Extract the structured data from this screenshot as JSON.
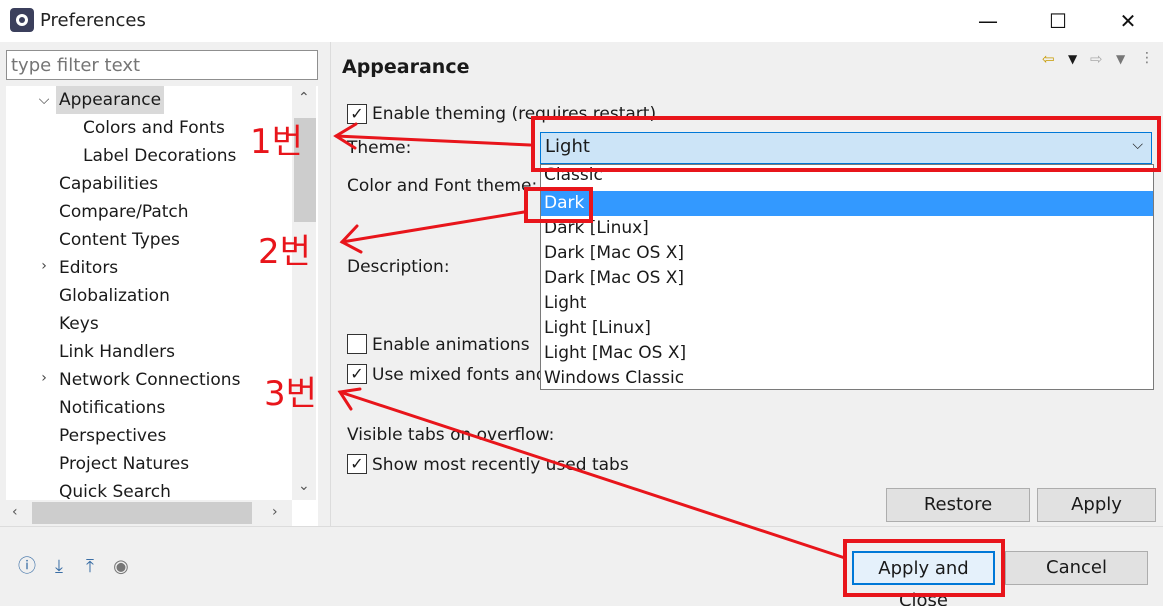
{
  "window": {
    "title": "Preferences",
    "minimize": "—",
    "maximize": "☐",
    "close": "✕"
  },
  "filter": {
    "placeholder": "type filter text"
  },
  "tree": {
    "items": [
      {
        "label": "Appearance",
        "twisty": "expanded",
        "selected": true
      },
      {
        "label": "Colors and Fonts"
      },
      {
        "label": "Label Decorations"
      },
      {
        "label": "Capabilities"
      },
      {
        "label": "Compare/Patch"
      },
      {
        "label": "Content Types"
      },
      {
        "label": "Editors",
        "twisty": "collapsed"
      },
      {
        "label": "Globalization"
      },
      {
        "label": "Keys"
      },
      {
        "label": "Link Handlers"
      },
      {
        "label": "Network Connections",
        "twisty": "collapsed"
      },
      {
        "label": "Notifications"
      },
      {
        "label": "Perspectives"
      },
      {
        "label": "Project Natures"
      },
      {
        "label": "Quick Search"
      }
    ]
  },
  "page": {
    "title": "Appearance",
    "enable_theming": "Enable theming (requires restart)",
    "theme_label": "Theme:",
    "theme_value": "Light",
    "color_font_theme_label": "Color and Font theme:",
    "description_label": "Description:",
    "enable_animations": "Enable animations",
    "mixed_fonts": "Use mixed fonts and colors for labels",
    "visible_tabs_label": "Visible tabs on overflow:",
    "show_recent_tabs": "Show most recently used tabs",
    "restore_defaults": "Restore Defaults",
    "apply": "Apply"
  },
  "dropdown": {
    "options": [
      "Classic",
      "Dark",
      "Dark [Linux]",
      "Dark [Mac OS X]",
      "Dark [Mac OS X]",
      "Light",
      "Light [Linux]",
      "Light [Mac OS X]",
      "Windows Classic"
    ],
    "highlighted": "Dark"
  },
  "footer": {
    "apply_and_close": "Apply and Close",
    "cancel": "Cancel"
  },
  "annotations": {
    "a1": "1번",
    "a2": "2번",
    "a3": "3번"
  },
  "colors": {
    "accent": "#0078d7",
    "annotation_red": "#e8151b",
    "selection_bg": "#3399ff"
  }
}
